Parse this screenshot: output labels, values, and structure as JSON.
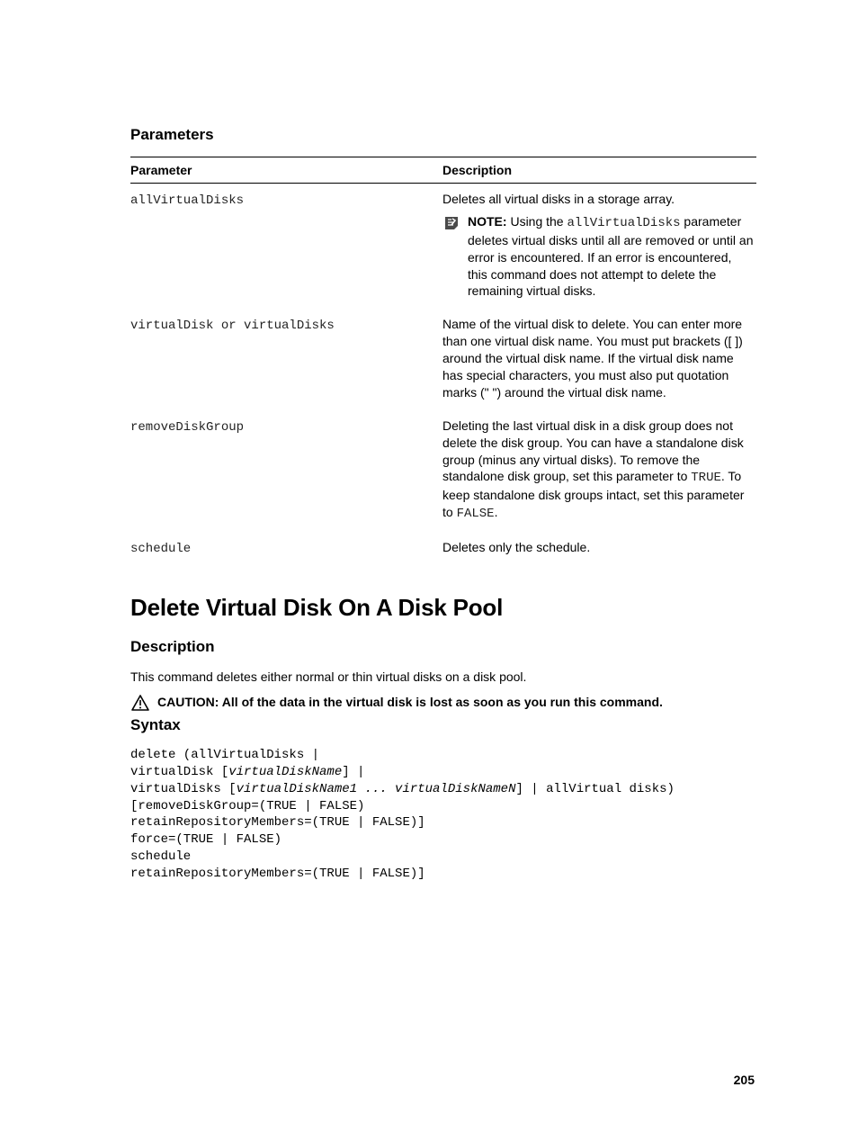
{
  "section1": {
    "title": "Parameters"
  },
  "table": {
    "headers": {
      "param": "Parameter",
      "desc": "Description"
    },
    "rows": {
      "r0": {
        "param": "allVirtualDisks",
        "desc": "Deletes all virtual disks in a storage array.",
        "note_label": "NOTE: ",
        "note_pre": "Using the ",
        "note_code": "allVirtualDisks",
        "note_post": " parameter deletes virtual disks until all are removed or until an error is encountered. If an error is encountered, this command does not attempt to delete the remaining virtual disks."
      },
      "r1": {
        "param": "virtualDisk or virtualDisks",
        "desc": "Name of the virtual disk to delete. You can enter more than one virtual disk name. You must put brackets ([ ]) around the virtual disk name. If the virtual disk name has special characters, you must also put quotation marks (\" \") around the virtual disk name."
      },
      "r2": {
        "param": "removeDiskGroup",
        "desc_pre": "Deleting the last virtual disk in a disk group does not delete the disk group. You can have a standalone disk group (minus any virtual disks). To remove the standalone disk group, set this parameter to ",
        "code1": "TRUE",
        "desc_mid": ". To keep standalone disk groups intact, set this parameter to ",
        "code2": "FALSE",
        "desc_post": "."
      },
      "r3": {
        "param": "schedule",
        "desc": "Deletes only the schedule."
      }
    }
  },
  "topic": {
    "title": "Delete Virtual Disk On A Disk Pool"
  },
  "desc": {
    "title": "Description",
    "body": "This command deletes either normal or thin virtual disks on a disk pool.",
    "caution": "CAUTION: All of the data in the virtual disk is lost as soon as you run this command."
  },
  "syntax": {
    "title": "Syntax",
    "l1": "delete (allVirtualDisks |",
    "l2a": "virtualDisk [",
    "l2b": "virtualDiskName",
    "l2c": "] |",
    "l3a": "virtualDisks [",
    "l3b": "virtualDiskName1 ... virtualDiskNameN",
    "l3c": "] | allVirtual disks)",
    "l4": "[removeDiskGroup=(TRUE | FALSE)",
    "l5": "retainRepositoryMembers=(TRUE | FALSE)]",
    "l6": "force=(TRUE | FALSE)",
    "l7": "schedule",
    "l8": "retainRepositoryMembers=(TRUE | FALSE)]"
  },
  "page": "205"
}
